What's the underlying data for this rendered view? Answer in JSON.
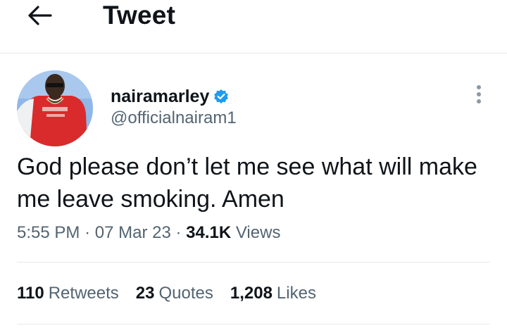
{
  "header": {
    "title": "Tweet",
    "back_icon": "arrow-left-icon"
  },
  "author": {
    "name": "nairamarley",
    "handle": "@officialnairam1",
    "verified": true,
    "verified_color": "#1d9bf0",
    "avatar_desc_colors": {
      "background": "#8fb7e8",
      "shirt": "#d92b2b"
    }
  },
  "tweet": {
    "text": "God please don’t let me see what will make me leave smoking. Amen",
    "time": "5:55 PM",
    "date": "07 Mar 23",
    "views_count": "34.1K",
    "views_label": "Views"
  },
  "stats": {
    "retweets_count": "110",
    "retweets_label": "Retweets",
    "quotes_count": "23",
    "quotes_label": "Quotes",
    "likes_count": "1,208",
    "likes_label": "Likes"
  }
}
